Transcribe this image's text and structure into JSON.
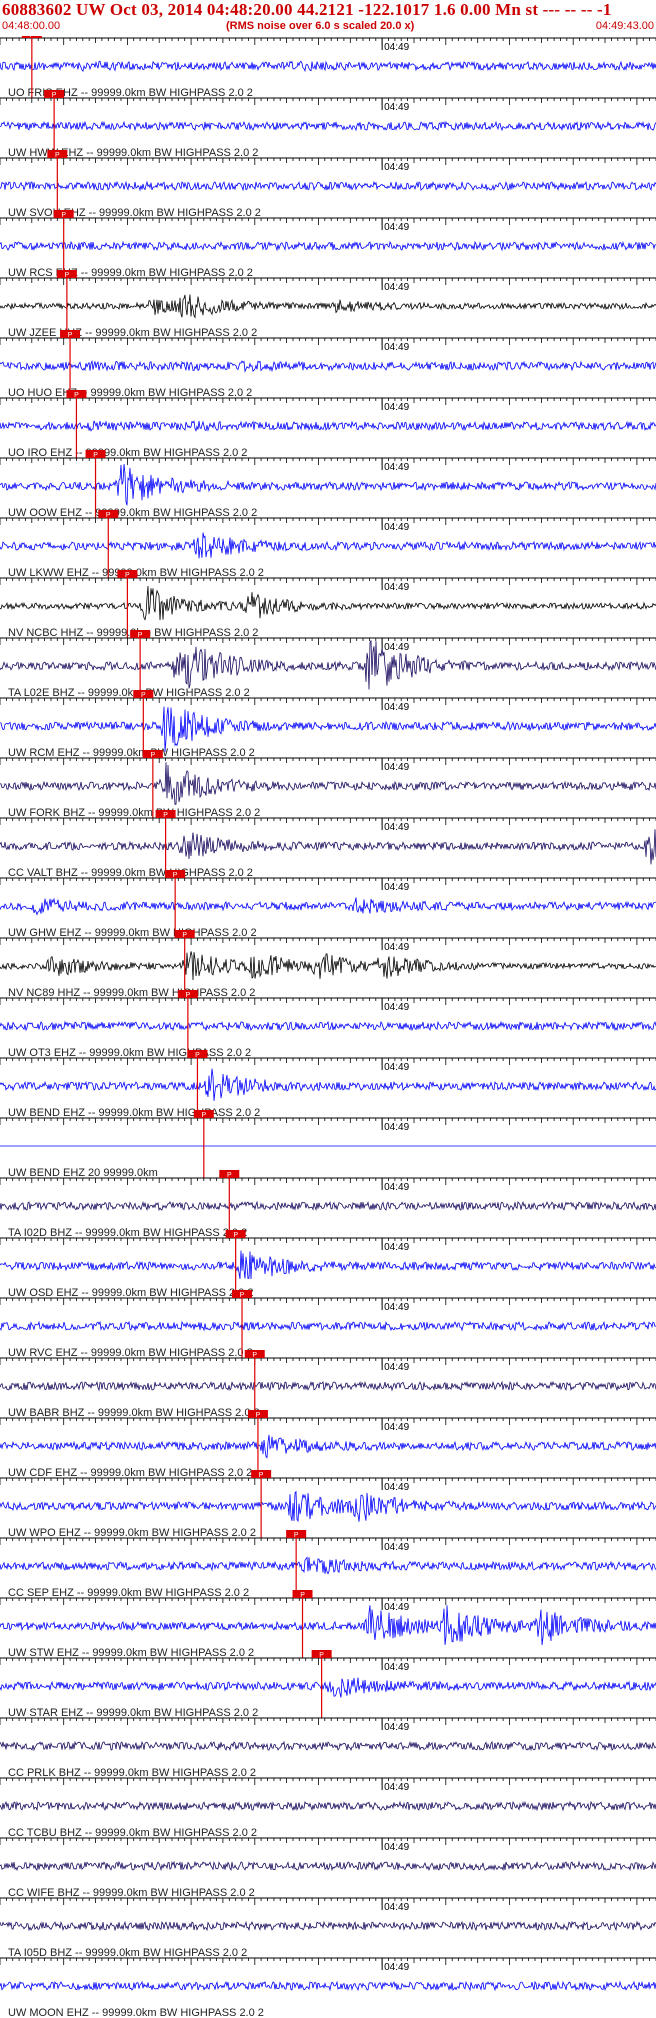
{
  "header": {
    "title": "60883602 UW Oct 03, 2014 04:48:20.00   44.2121 -122.1017  1.6 0.00 Mn st --- -- --  -1",
    "left_time": "04:48:00.00",
    "center_note": "(RMS noise over 6.0 s scaled 20.0 x)",
    "right_time": "04:49:43.00",
    "accent_color": "#cc0000"
  },
  "chart_data": {
    "type": "seismogram",
    "time_start": "04:48:00.00",
    "time_end": "04:49:43.00",
    "minute_mark_label": "04:49",
    "minute_mark_time_s": 60,
    "duration_s": 103,
    "pick_label": "P",
    "traces": [
      {
        "label": "UO FRIS EHZ -- 99999.0km BW  HIGHPASS  2.0  2",
        "color": "#0000ff",
        "pick_s": 5.0,
        "events": [
          [
            13.0,
            0.08
          ],
          [
            46.0,
            0.08
          ]
        ]
      },
      {
        "label": "UW HWW EHZ -- 99999.0km BW  HIGHPASS  2.0  2",
        "color": "#0000ff",
        "pick_s": 8.5,
        "events": []
      },
      {
        "label": "UW SVOH EHZ -- 99999.0km BW  HIGHPASS  2.0  2",
        "color": "#0000ff",
        "pick_s": 9.0,
        "events": []
      },
      {
        "label": "UW RCS EHZ -- 99999.0km BW  HIGHPASS  2.0  2",
        "color": "#0000ff",
        "pick_s": 10.0,
        "events": []
      },
      {
        "label": "UW JZEE HHZ -- 99999.0km BW  HIGHPASS  2.0  2",
        "color": "#000000",
        "pick_s": 10.5,
        "events": [
          [
            24.0,
            0.35
          ],
          [
            29.0,
            0.6
          ],
          [
            53.0,
            0.25
          ]
        ]
      },
      {
        "label": "UO HUO EHZ -- 99999.0km BW  HIGHPASS  2.0  2",
        "color": "#0000ff",
        "pick_s": 11.0,
        "events": [
          [
            14.0,
            0.08
          ],
          [
            30.0,
            0.08
          ],
          [
            38.0,
            0.08
          ]
        ]
      },
      {
        "label": "UO IRO EHZ -- 99999.0km BW  HIGHPASS  2.0  2",
        "color": "#0000ff",
        "pick_s": 12.0,
        "events": [
          [
            14.5,
            0.08
          ],
          [
            30.0,
            0.08
          ]
        ]
      },
      {
        "label": "UW OOW EHZ -- 99999.0km BW  HIGHPASS  2.0  2",
        "color": "#0000ff",
        "pick_s": 15.0,
        "events": [
          [
            19.0,
            1.2
          ]
        ]
      },
      {
        "label": "UW LKWW EHZ -- 99999.0km BW  HIGHPASS  2.0  2",
        "color": "#0000ff",
        "pick_s": 17.0,
        "events": [
          [
            31.0,
            0.7
          ]
        ]
      },
      {
        "label": "NV NCBC HHZ -- 99999.0km BW  HIGHPASS  2.0  2",
        "color": "#000000",
        "pick_s": 20.0,
        "events": [
          [
            23.0,
            1.0
          ],
          [
            39.0,
            0.7
          ]
        ]
      },
      {
        "label": "TA L02E BHZ -- 99999.0km BW  HIGHPASS  2.0  2",
        "color": "#1a0a5e",
        "pick_s": 22.0,
        "events": [
          [
            28.0,
            2.0
          ],
          [
            58.0,
            1.6
          ]
        ]
      },
      {
        "label": "UW RCM EHZ -- 99999.0km BW  HIGHPASS  2.0  2",
        "color": "#0000ff",
        "pick_s": 22.5,
        "events": [
          [
            26.0,
            1.5
          ]
        ]
      },
      {
        "label": "UW FORK BHZ -- 99999.0km BW  HIGHPASS  2.0  2",
        "color": "#1a0a5e",
        "pick_s": 24.0,
        "events": [
          [
            26.0,
            1.2
          ]
        ]
      },
      {
        "label": "CC VALT BHZ -- 99999.0km BW  HIGHPASS  2.0  2",
        "color": "#1a0a5e",
        "pick_s": 26.0,
        "events": [
          [
            29.0,
            0.7
          ],
          [
            102.0,
            0.9
          ]
        ]
      },
      {
        "label": "UW GHW EHZ -- 99999.0km BW  HIGHPASS  2.0  2",
        "color": "#0000ff",
        "pick_s": 27.5,
        "events": [
          [
            5.5,
            0.3
          ],
          [
            56.0,
            0.3
          ]
        ]
      },
      {
        "label": "NV NC89 HHZ -- 99999.0km BW  HIGHPASS  2.0  2",
        "color": "#000000",
        "pick_s": 29.0,
        "events": [
          [
            8.0,
            0.6
          ],
          [
            29.5,
            0.8
          ],
          [
            40.0,
            0.7
          ],
          [
            50.0,
            0.6
          ],
          [
            60.0,
            0.6
          ]
        ]
      },
      {
        "label": "UW OT3 EHZ -- 99999.0km BW  HIGHPASS  2.0  2",
        "color": "#0000ff",
        "pick_s": 29.5,
        "events": []
      },
      {
        "label": "UW BEND EHZ -- 99999.0km BW  HIGHPASS  2.0  2",
        "color": "#0000ff",
        "pick_s": 31.0,
        "events": [
          [
            33.0,
            0.8
          ]
        ]
      },
      {
        "label": "UW BEND EHZ 20 99999.0km",
        "color": "#0000ff",
        "pick_s": 32.0,
        "events": []
      },
      {
        "label": "TA I02D BHZ -- 99999.0km BW  HIGHPASS  2.0  2",
        "color": "#1a0a5e",
        "pick_s": 36.0,
        "events": []
      },
      {
        "label": "UW OSD EHZ -- 99999.0km BW  HIGHPASS  2.0  2",
        "color": "#0000ff",
        "pick_s": 37.0,
        "events": [
          [
            38.0,
            0.9
          ]
        ]
      },
      {
        "label": "UW RVC EHZ -- 99999.0km BW  HIGHPASS  2.0  2",
        "color": "#0000ff",
        "pick_s": 38.0,
        "events": []
      },
      {
        "label": "UW BABR BHZ -- 99999.0km BW  HIGHPASS  2.0  2",
        "color": "#1a0a5e",
        "pick_s": 40.0,
        "events": []
      },
      {
        "label": "UW CDF EHZ -- 99999.0km BW  HIGHPASS  2.0  2",
        "color": "#0000ff",
        "pick_s": 40.5,
        "events": [
          [
            41.5,
            0.5
          ]
        ]
      },
      {
        "label": "UW WPO EHZ -- 99999.0km BW  HIGHPASS  2.0  2",
        "color": "#0000ff",
        "pick_s": 41.0,
        "events": [
          [
            46.0,
            0.9
          ],
          [
            56.0,
            0.7
          ]
        ]
      },
      {
        "label": "CC SEP EHZ -- 99999.0km BW  HIGHPASS  2.0  2",
        "color": "#0000ff",
        "pick_s": 46.5,
        "events": [
          [
            48.0,
            0.4
          ]
        ]
      },
      {
        "label": "UW STW EHZ -- 99999.0km BW  HIGHPASS  2.0  2",
        "color": "#0000ff",
        "pick_s": 47.5,
        "events": [
          [
            58.0,
            1.0
          ],
          [
            70.0,
            1.0
          ],
          [
            85.0,
            0.9
          ]
        ]
      },
      {
        "label": "UW STAR EHZ -- 99999.0km BW  HIGHPASS  2.0  2",
        "color": "#0000ff",
        "pick_s": 50.5,
        "events": [
          [
            52.0,
            0.6
          ]
        ]
      },
      {
        "label": "CC PRLK BHZ -- 99999.0km BW  HIGHPASS  2.0  2",
        "color": "#1a0a5e",
        "pick_s": null,
        "events": []
      },
      {
        "label": "CC TCBU BHZ -- 99999.0km BW  HIGHPASS  2.0  2",
        "color": "#1a0a5e",
        "pick_s": null,
        "events": []
      },
      {
        "label": "CC WIFE BHZ -- 99999.0km BW  HIGHPASS  2.0  2",
        "color": "#1a0a5e",
        "pick_s": null,
        "events": []
      },
      {
        "label": "TA I05D BHZ -- 99999.0km BW  HIGHPASS  2.0  2",
        "color": "#1a0a5e",
        "pick_s": null,
        "events": []
      },
      {
        "label": "UW MOON EHZ -- 99999.0km BW  HIGHPASS  2.0  2",
        "color": "#0000ff",
        "pick_s": null,
        "events": []
      }
    ]
  }
}
